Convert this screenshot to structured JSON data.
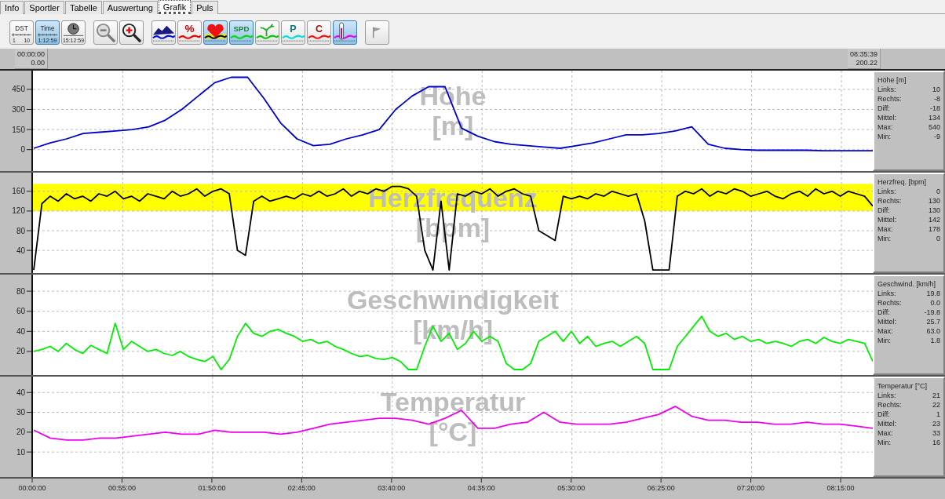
{
  "tabs": [
    {
      "label": "Info",
      "selected": false
    },
    {
      "label": "Sportler",
      "selected": false
    },
    {
      "label": "Tabelle",
      "selected": false
    },
    {
      "label": "Auswertung",
      "selected": false
    },
    {
      "label": "Grafik",
      "selected": true
    },
    {
      "label": "Puls",
      "selected": false
    }
  ],
  "toolbar": [
    {
      "kind": "dst",
      "labels": [
        "DST",
        "1",
        "10"
      ],
      "selected": false
    },
    {
      "kind": "time",
      "labels": [
        "Time",
        "1:12:59"
      ],
      "selected": true
    },
    {
      "kind": "clock",
      "labels": [
        "15:12:59"
      ],
      "selected": false
    },
    {
      "kind": "zoom-out",
      "selected": false
    },
    {
      "kind": "zoom-in",
      "selected": false
    },
    {
      "kind": "elevation",
      "selected": false
    },
    {
      "kind": "percent",
      "labels": [
        "%"
      ],
      "selected": false
    },
    {
      "kind": "heart",
      "selected": true
    },
    {
      "kind": "speed",
      "labels": [
        "SPD"
      ],
      "selected": true
    },
    {
      "kind": "cadence",
      "selected": false
    },
    {
      "kind": "power",
      "labels": [
        "P"
      ],
      "selected": false
    },
    {
      "kind": "calories",
      "labels": [
        "C"
      ],
      "selected": false
    },
    {
      "kind": "temperature",
      "selected": true
    },
    {
      "kind": "flag",
      "selected": false
    }
  ],
  "time_header": {
    "start": [
      "00:00:00",
      "0.00"
    ],
    "end": [
      "08:35:39",
      "200.22"
    ]
  },
  "panels": [
    {
      "chart_data": {
        "type": "line",
        "title": "Höhe [m]",
        "grid": true,
        "ylim": [
          -160,
          590
        ],
        "yticks": [
          0,
          150,
          300,
          450
        ],
        "categories": [
          null,
          null,
          null,
          null,
          null,
          null,
          null,
          null,
          null,
          null,
          null,
          null,
          null,
          null,
          null,
          null,
          null,
          null,
          null,
          null,
          null,
          null,
          null,
          null,
          null,
          null,
          null,
          null,
          null,
          null,
          null,
          null,
          null,
          null,
          null,
          null,
          null,
          null,
          null,
          null,
          null,
          null,
          null,
          null,
          null,
          null,
          null,
          null,
          null,
          null,
          null,
          null
        ],
        "series": [
          {
            "color": "#0000cc",
            "values": [
              10,
              50,
              80,
              120,
              130,
              140,
              150,
              170,
              220,
              300,
              400,
              500,
              540,
              540,
              380,
              200,
              80,
              30,
              40,
              80,
              110,
              150,
              300,
              400,
              470,
              470,
              160,
              100,
              60,
              40,
              30,
              20,
              10,
              30,
              50,
              80,
              110,
              110,
              120,
              140,
              170,
              40,
              10,
              0,
              -5,
              -5,
              -5,
              -5,
              -8,
              -8,
              -8,
              -8
            ]
          }
        ]
      },
      "stats": {
        "title": "Höhe [m]",
        "rows": [
          {
            "label": "Links:",
            "value": "10"
          },
          {
            "label": "Rechts:",
            "value": "-8"
          },
          {
            "label": "Diff:",
            "value": "-18"
          },
          {
            "label": "Mittel:",
            "value": "134"
          },
          {
            "label": "Max:",
            "value": "540"
          },
          {
            "label": "Min:",
            "value": "-9"
          }
        ]
      }
    },
    {
      "chart_data": {
        "type": "line",
        "title": "Herzfrequenz [bpm]",
        "ylim": [
          -6,
          198
        ],
        "yticks": [
          40,
          80,
          120,
          160
        ],
        "grid": true,
        "bands": [
          {
            "axis": "y",
            "from": 120,
            "to": 175,
            "color": "#ffff00"
          }
        ],
        "categories": [
          null,
          null,
          null,
          null,
          null,
          null,
          null,
          null,
          null,
          null,
          null,
          null,
          null,
          null,
          null,
          null,
          null,
          null,
          null,
          null,
          null,
          null,
          null,
          null,
          null,
          null,
          null,
          null,
          null,
          null,
          null,
          null,
          null,
          null,
          null,
          null,
          null,
          null,
          null,
          null,
          null,
          null,
          null,
          null,
          null,
          null,
          null,
          null,
          null,
          null,
          null,
          null,
          null,
          null,
          null,
          null,
          null,
          null,
          null,
          null,
          null,
          null,
          null,
          null,
          null,
          null,
          null,
          null,
          null,
          null,
          null,
          null,
          null,
          null,
          null,
          null,
          null,
          null,
          null,
          null,
          null,
          null,
          null,
          null,
          null,
          null,
          null,
          null,
          null,
          null,
          null,
          null,
          null,
          null,
          null,
          null,
          null,
          null,
          null,
          null,
          null,
          null,
          null,
          null
        ],
        "series": [
          {
            "color": "#000000",
            "values": [
              0,
              135,
              150,
              140,
              155,
              145,
              150,
              140,
              155,
              150,
              160,
              145,
              150,
              140,
              155,
              150,
              145,
              160,
              150,
              155,
              165,
              150,
              160,
              165,
              155,
              40,
              30,
              140,
              150,
              140,
              145,
              150,
              145,
              155,
              150,
              160,
              150,
              155,
              165,
              150,
              160,
              155,
              165,
              160,
              170,
              170,
              165,
              150,
              40,
              0,
              140,
              0,
              155,
              150,
              160,
              155,
              165,
              150,
              160,
              165,
              155,
              150,
              80,
              70,
              60,
              150,
              145,
              150,
              145,
              155,
              150,
              160,
              155,
              150,
              155,
              100,
              0,
              0,
              0,
              150,
              160,
              155,
              165,
              150,
              160,
              155,
              165,
              160,
              150,
              155,
              160,
              150,
              145,
              155,
              160,
              150,
              165,
              155,
              160,
              150,
              160,
              155,
              150,
              130
            ]
          }
        ]
      },
      "stats": {
        "title": "Herzfreq. [bpm]",
        "rows": [
          {
            "label": "Links:",
            "value": "0"
          },
          {
            "label": "Rechts:",
            "value": "130"
          },
          {
            "label": "Diff:",
            "value": "130"
          },
          {
            "label": "Mittel:",
            "value": "142"
          },
          {
            "label": "Max:",
            "value": "178"
          },
          {
            "label": "Min:",
            "value": "0"
          }
        ]
      }
    },
    {
      "chart_data": {
        "type": "line",
        "title": "Geschwindigkeit [km/h]",
        "grid": true,
        "ylim": [
          -3.5,
          96.5
        ],
        "yticks": [
          20,
          40,
          60,
          80
        ],
        "categories": [
          null,
          null,
          null,
          null,
          null,
          null,
          null,
          null,
          null,
          null,
          null,
          null,
          null,
          null,
          null,
          null,
          null,
          null,
          null,
          null,
          null,
          null,
          null,
          null,
          null,
          null,
          null,
          null,
          null,
          null,
          null,
          null,
          null,
          null,
          null,
          null,
          null,
          null,
          null,
          null,
          null,
          null,
          null,
          null,
          null,
          null,
          null,
          null,
          null,
          null,
          null,
          null,
          null,
          null,
          null,
          null,
          null,
          null,
          null,
          null,
          null,
          null,
          null,
          null,
          null,
          null,
          null,
          null,
          null,
          null,
          null,
          null,
          null,
          null,
          null,
          null,
          null,
          null,
          null,
          null,
          null,
          null,
          null,
          null,
          null,
          null,
          null,
          null,
          null,
          null,
          null,
          null,
          null,
          null,
          null,
          null,
          null,
          null,
          null,
          null,
          null,
          null,
          null,
          null
        ],
        "series": [
          {
            "color": "#00ee00",
            "values": [
              20,
              22,
              25,
              20,
              28,
              22,
              18,
              26,
              22,
              18,
              48,
              22,
              30,
              25,
              20,
              22,
              18,
              16,
              20,
              15,
              12,
              10,
              15,
              2,
              12,
              35,
              48,
              38,
              35,
              40,
              42,
              38,
              35,
              30,
              32,
              28,
              30,
              25,
              22,
              18,
              15,
              16,
              13,
              12,
              14,
              10,
              2,
              2,
              25,
              45,
              30,
              38,
              22,
              28,
              40,
              30,
              35,
              30,
              8,
              2,
              2,
              8,
              30,
              35,
              40,
              30,
              40,
              28,
              35,
              25,
              28,
              30,
              25,
              30,
              35,
              28,
              2,
              2,
              2,
              25,
              35,
              45,
              55,
              40,
              35,
              38,
              32,
              35,
              30,
              32,
              28,
              30,
              28,
              25,
              30,
              32,
              28,
              34,
              30,
              28,
              32,
              30,
              28,
              10
            ]
          }
        ]
      },
      "stats": {
        "title": "Geschwind. [km/h]",
        "rows": [
          {
            "label": "Links:",
            "value": "19.8"
          },
          {
            "label": "Rechts:",
            "value": "0.0"
          },
          {
            "label": "Diff:",
            "value": "-19.8"
          },
          {
            "label": "Mittel:",
            "value": "25.7"
          },
          {
            "label": "Max:",
            "value": "63.0"
          },
          {
            "label": "Min:",
            "value": "1.8"
          }
        ]
      }
    },
    {
      "chart_data": {
        "type": "line",
        "title": "Temperatur [°C]",
        "grid": true,
        "ylim": [
          -2.6,
          48
        ],
        "yticks": [
          10,
          20,
          30,
          40
        ],
        "categories": [
          null,
          null,
          null,
          null,
          null,
          null,
          null,
          null,
          null,
          null,
          null,
          null,
          null,
          null,
          null,
          null,
          null,
          null,
          null,
          null,
          null,
          null,
          null,
          null,
          null,
          null,
          null,
          null,
          null,
          null,
          null,
          null,
          null,
          null,
          null,
          null,
          null,
          null,
          null,
          null,
          null,
          null,
          null,
          null,
          null,
          null,
          null,
          null,
          null,
          null,
          null,
          null
        ],
        "series": [
          {
            "color": "#ee00ee",
            "values": [
              21,
              17,
              16,
              16,
              17,
              17,
              18,
              19,
              20,
              19,
              19,
              21,
              20,
              20,
              20,
              19,
              20,
              22,
              24,
              25,
              26,
              27,
              27,
              26,
              24,
              27,
              31,
              22,
              22,
              24,
              25,
              30,
              25,
              24,
              24,
              24,
              25,
              27,
              29,
              33,
              28,
              26,
              26,
              25,
              25,
              24,
              24,
              25,
              24,
              24,
              23,
              22
            ]
          }
        ]
      },
      "stats": {
        "title": "Temperatur [°C]",
        "rows": [
          {
            "label": "Links:",
            "value": "21"
          },
          {
            "label": "Rechts:",
            "value": "22"
          },
          {
            "label": "Diff:",
            "value": "1"
          },
          {
            "label": "Mittel:",
            "value": "23"
          },
          {
            "label": "Max:",
            "value": "33"
          },
          {
            "label": "Min:",
            "value": "16"
          }
        ]
      }
    }
  ],
  "time_axis": {
    "labels": [
      "00:00:00",
      "00:55:00",
      "01:50:00",
      "02:45:00",
      "03:40:00",
      "04:35:00",
      "05:30:00",
      "06:25:00",
      "07:20:00",
      "08:15:00"
    ]
  }
}
